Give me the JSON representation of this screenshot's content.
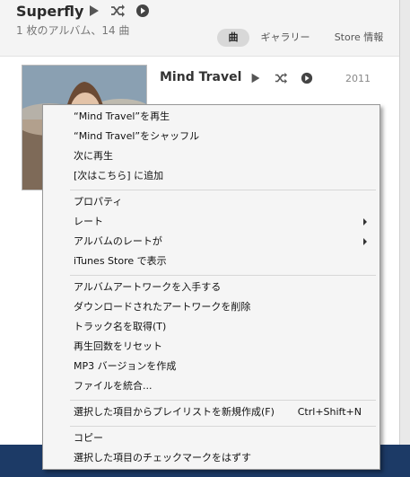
{
  "header": {
    "artist": "Superfly",
    "subtitle": "1 枚のアルバム、14 曲",
    "tabs": [
      {
        "label": "曲"
      },
      {
        "label": "ギャラリー"
      },
      {
        "label": "Store 情報"
      }
    ]
  },
  "album": {
    "title": "Mind Travel",
    "year": "2011"
  },
  "context_menu": {
    "items": [
      {
        "label": "“Mind Travel”を再生"
      },
      {
        "label": "“Mind Travel”をシャッフル"
      },
      {
        "label": "次に再生"
      },
      {
        "label": "[次はこちら] に追加"
      },
      {
        "label": "プロパティ"
      },
      {
        "label": "レート"
      },
      {
        "label": "アルバムのレートが"
      },
      {
        "label": "iTunes Store で表示"
      },
      {
        "label": "アルバムアートワークを入手する"
      },
      {
        "label": "ダウンロードされたアートワークを削除"
      },
      {
        "label": "トラック名を取得(T)"
      },
      {
        "label": "再生回数をリセット"
      },
      {
        "label": "MP3 バージョンを作成"
      },
      {
        "label": "ファイルを統合..."
      },
      {
        "label": "選択した項目からプレイリストを新規作成(F)",
        "shortcut": "Ctrl+Shift+N"
      },
      {
        "label": "コピー"
      },
      {
        "label": "選択した項目のチェックマークをはずす"
      }
    ]
  }
}
